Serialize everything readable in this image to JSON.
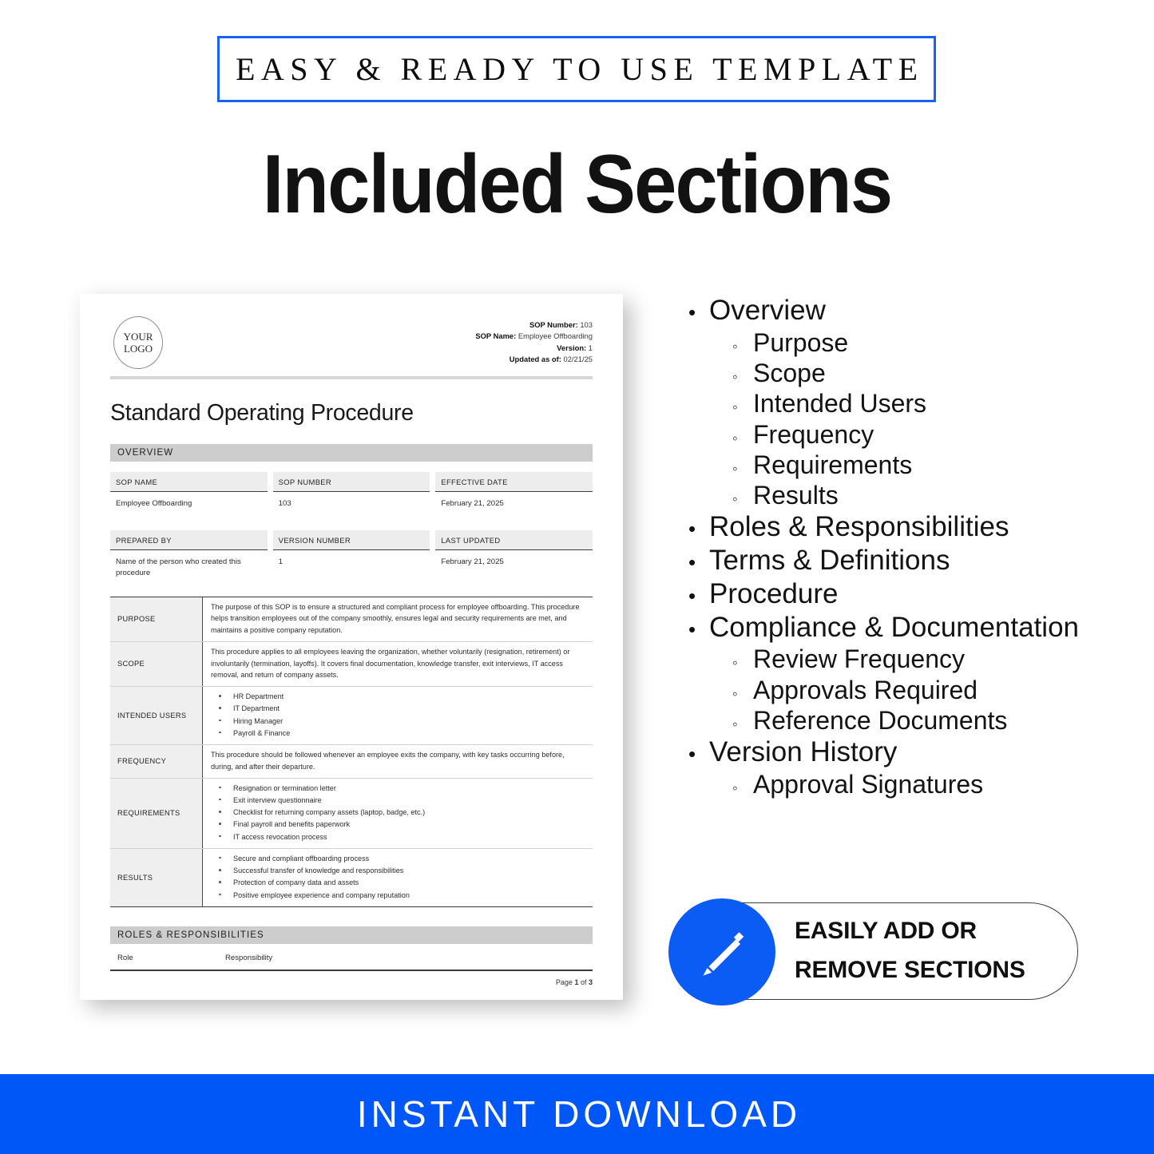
{
  "ribbon": {
    "text": "EASY & READY TO USE TEMPLATE",
    "border_color": "#1763f0"
  },
  "headline": "Included Sections",
  "document": {
    "logo": {
      "line1": "YOUR",
      "line2": "LOGO"
    },
    "header_meta": [
      {
        "label": "SOP Number:",
        "value": "103"
      },
      {
        "label": "SOP Name:",
        "value": "Employee Offboarding"
      },
      {
        "label": "Version:",
        "value": "1"
      },
      {
        "label": "Updated as of:",
        "value": "02/21/25"
      }
    ],
    "title": "Standard Operating Procedure",
    "section_band_1": "OVERVIEW",
    "info_row_1": [
      {
        "header": "SOP NAME",
        "value": "Employee Offboarding"
      },
      {
        "header": "SOP NUMBER",
        "value": "103"
      },
      {
        "header": "EFFECTIVE DATE",
        "value": "February 21, 2025"
      }
    ],
    "info_row_2": [
      {
        "header": "PREPARED BY",
        "value": "Name of the person who created this procedure"
      },
      {
        "header": "VERSION NUMBER",
        "value": "1"
      },
      {
        "header": "LAST UPDATED",
        "value": "February 21, 2025"
      }
    ],
    "detail_rows": [
      {
        "label": "PURPOSE",
        "paragraph": "The purpose of this SOP is to ensure a structured and compliant process for employee offboarding. This procedure helps transition employees out of the company smoothly, ensures legal and security requirements are met, and maintains a positive company reputation."
      },
      {
        "label": "SCOPE",
        "paragraph": "This procedure applies to all employees leaving the organization, whether voluntarily (resignation, retirement) or involuntarily (termination, layoffs). It covers final documentation, knowledge transfer, exit interviews, IT access removal, and return of company assets."
      },
      {
        "label": "INTENDED USERS",
        "bullets": [
          "HR Department",
          "IT Department",
          "Hiring Manager",
          "Payroll & Finance"
        ]
      },
      {
        "label": "FREQUENCY",
        "paragraph": "This procedure should be followed whenever an employee exits the company, with key tasks occurring before, during, and after their departure."
      },
      {
        "label": "REQUIREMENTS",
        "bullets": [
          "Resignation or termination letter",
          "Exit interview questionnaire",
          "Checklist for returning company assets (laptop, badge, etc.)",
          "Final payroll and benefits paperwork",
          "IT access revocation process"
        ]
      },
      {
        "label": "RESULTS",
        "bullets": [
          "Secure and compliant offboarding process",
          "Successful transfer of knowledge and responsibilities",
          "Protection of company data and assets",
          "Positive employee experience and company reputation"
        ]
      }
    ],
    "section_band_2": "ROLES & RESPONSIBILITIES",
    "roles_headers": [
      "Role",
      "Responsibility"
    ],
    "footer": {
      "prefix": "Page ",
      "page": "1",
      "middle": " of ",
      "total": "3"
    }
  },
  "section_list": [
    {
      "level": 1,
      "label": "Overview"
    },
    {
      "level": 2,
      "label": "Purpose"
    },
    {
      "level": 2,
      "label": "Scope"
    },
    {
      "level": 2,
      "label": "Intended Users"
    },
    {
      "level": 2,
      "label": "Frequency"
    },
    {
      "level": 2,
      "label": "Requirements"
    },
    {
      "level": 2,
      "label": "Results"
    },
    {
      "level": 1,
      "label": "Roles & Responsibilities"
    },
    {
      "level": 1,
      "label": "Terms & Definitions"
    },
    {
      "level": 1,
      "label": "Procedure"
    },
    {
      "level": 1,
      "label": "Compliance & Documentation"
    },
    {
      "level": 2,
      "label": "Review Frequency"
    },
    {
      "level": 2,
      "label": "Approvals Required"
    },
    {
      "level": 2,
      "label": "Reference Documents"
    },
    {
      "level": 1,
      "label": "Version History"
    },
    {
      "level": 2,
      "label": "Approval Signatures"
    }
  ],
  "badge": {
    "line1": "EASILY ADD OR",
    "line2": "REMOVE SECTIONS",
    "icon": "pencil-icon",
    "accent_color": "#0b5cf5"
  },
  "banner": {
    "text": "INSTANT DOWNLOAD",
    "bg_color": "#0057f7"
  }
}
